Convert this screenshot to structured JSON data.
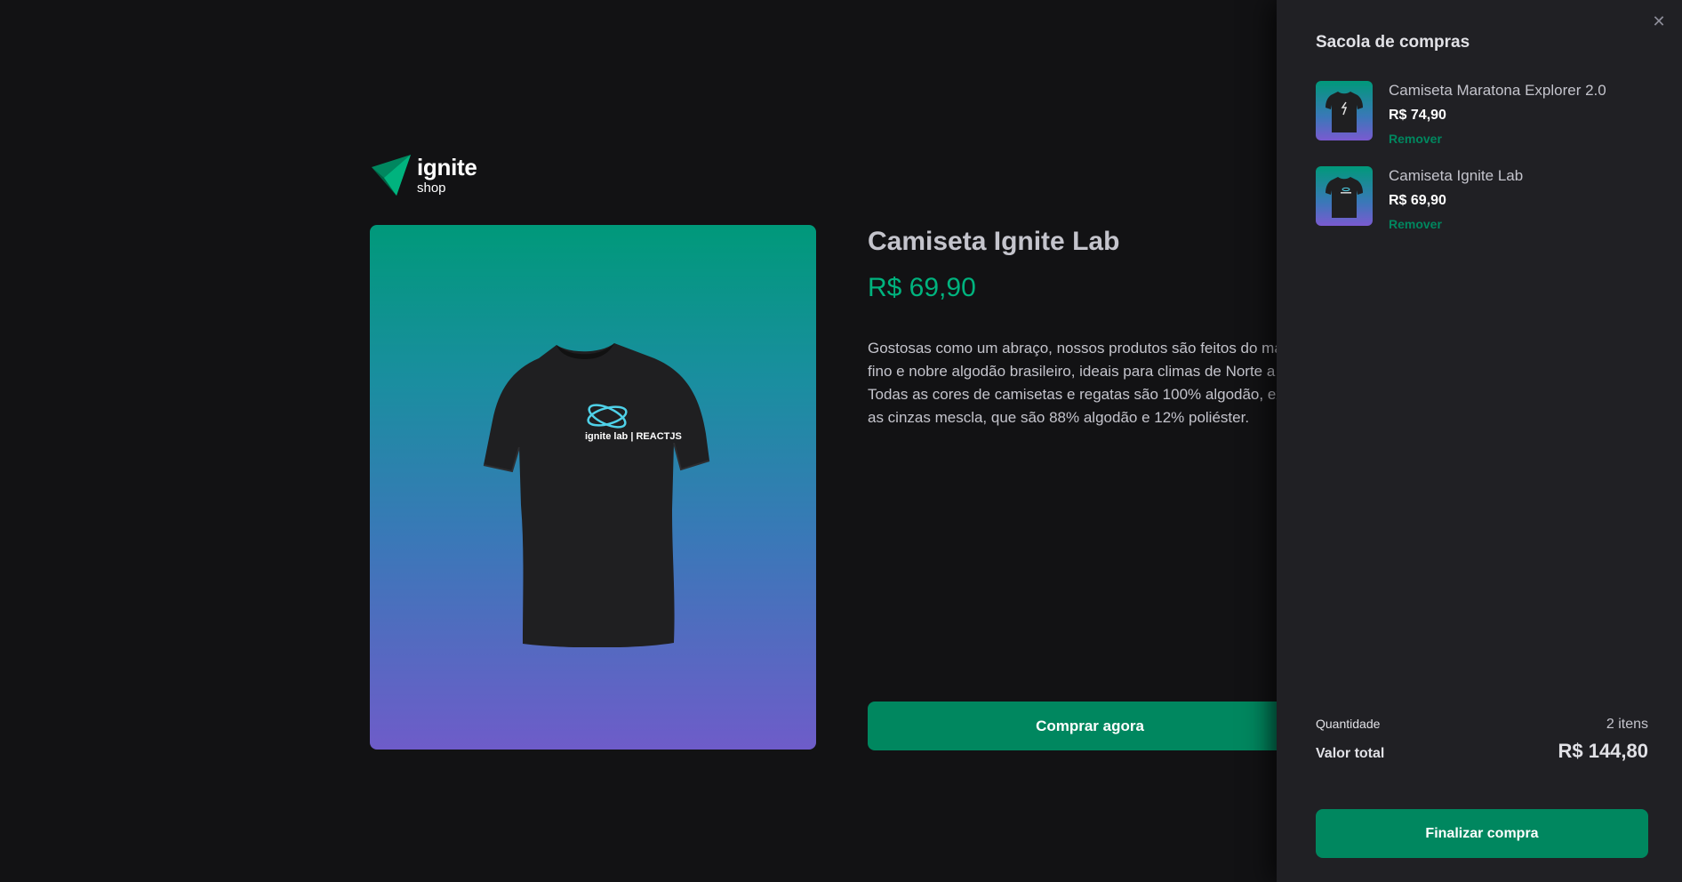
{
  "header": {
    "logo_title": "ignite",
    "logo_subtitle": "shop",
    "logo_icon": "ignite-triangle-logo"
  },
  "product": {
    "title": "Camiseta Ignite Lab",
    "price": "R$ 69,90",
    "description": "Gostosas como um abraço, nossos produtos são feitos do mais fino e nobre algodão brasileiro, ideais para climas de Norte a Sul. Todas as cores de camisetas e regatas são 100% algodão, exceto as cinzas mescla, que são 88% algodão e 12% poliéster.",
    "buy_label": "Comprar agora",
    "shirt_print": "ignite lab | REACTJS",
    "image_icon": "tshirt-image"
  },
  "cart": {
    "title": "Sacola de compras",
    "close_icon": "close-icon",
    "items": [
      {
        "name": "Camiseta Maratona Explorer 2.0",
        "price": "R$ 74,90",
        "remove_label": "Remover"
      },
      {
        "name": "Camiseta Ignite Lab",
        "price": "R$ 69,90",
        "remove_label": "Remover"
      }
    ],
    "quantity_label": "Quantidade",
    "quantity_value": "2 itens",
    "total_label": "Valor total",
    "total_value": "R$ 144,80",
    "checkout_label": "Finalizar compra"
  },
  "colors": {
    "background": "#121214",
    "panel": "#202024",
    "accent": "#00875f",
    "price_green": "#00b37e",
    "gradient_top": "#00997a",
    "gradient_bottom": "#7465d4"
  }
}
